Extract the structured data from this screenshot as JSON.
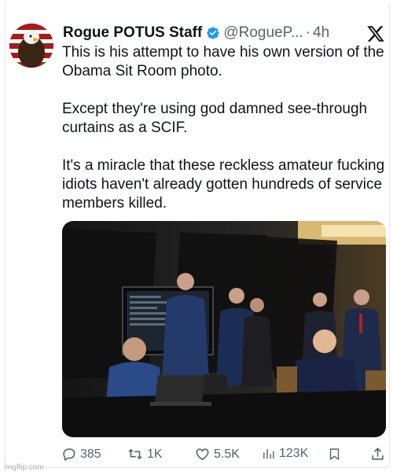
{
  "tweet": {
    "display_name": "Rogue POTUS Staff",
    "handle": "@RogueP...",
    "separator": "·",
    "time": "4h",
    "paragraphs": [
      "This is his attempt to have his own version of the Obama Sit Room photo.",
      "Except they're using god damned see-through curtains as a SCIF.",
      "It's a miracle that these reckless amateur fucking idiots haven't already gotten hundreds of service members killed."
    ]
  },
  "actions": {
    "replies": "385",
    "reposts": "1K",
    "likes": "5.5K",
    "views": "123K"
  },
  "icons": {
    "verified": "verified-badge-icon",
    "platform": "x-logo-icon",
    "reply": "reply-icon",
    "repost": "repost-icon",
    "like": "heart-icon",
    "views": "views-icon",
    "bookmark": "bookmark-icon",
    "share": "share-icon"
  },
  "colors": {
    "verified_blue": "#1d9bf0",
    "muted_text": "#536471"
  },
  "watermark": "imgflip.com"
}
